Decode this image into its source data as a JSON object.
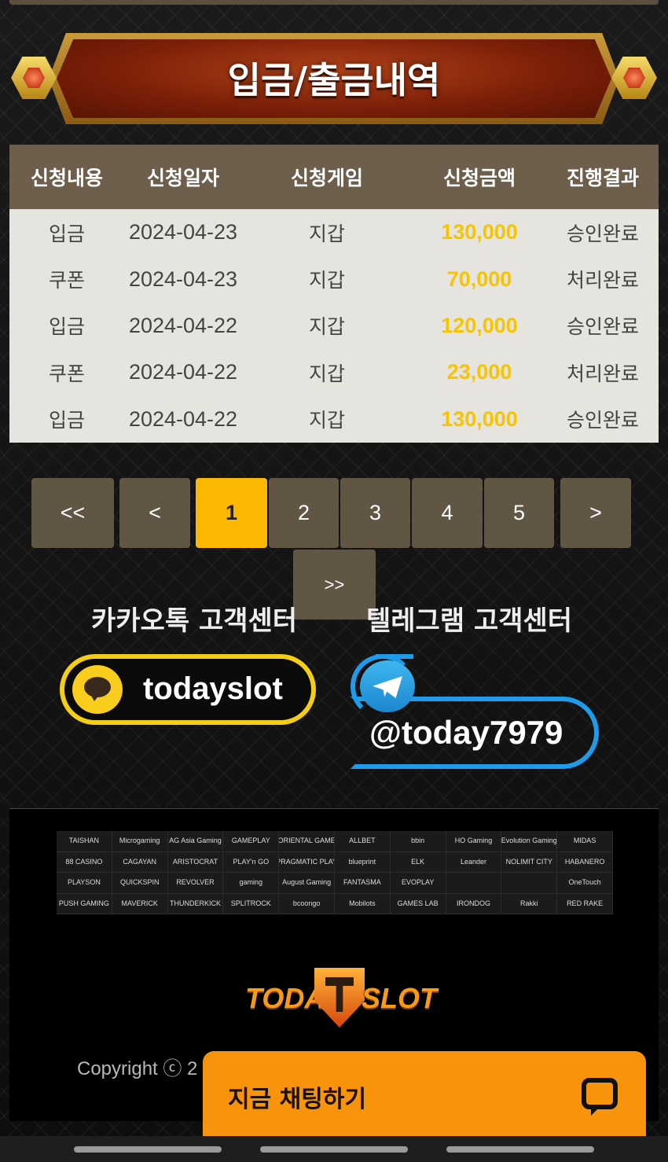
{
  "banner": {
    "title": "입금/출금내역"
  },
  "table": {
    "headers": [
      "신청내용",
      "신청일자",
      "신청게임",
      "신청금액",
      "진행결과"
    ],
    "rows": [
      [
        "입금",
        "2024-04-23",
        "지갑",
        "130,000",
        "승인완료"
      ],
      [
        "쿠폰",
        "2024-04-23",
        "지갑",
        "70,000",
        "처리완료"
      ],
      [
        "입금",
        "2024-04-22",
        "지갑",
        "120,000",
        "승인완료"
      ],
      [
        "쿠폰",
        "2024-04-22",
        "지갑",
        "23,000",
        "처리완료"
      ],
      [
        "입금",
        "2024-04-22",
        "지갑",
        "130,000",
        "승인완료"
      ]
    ]
  },
  "pagination": {
    "first": "<<",
    "prev": "<",
    "pages": [
      "1",
      "2",
      "3",
      "4",
      "5"
    ],
    "current": "1",
    "next": ">",
    "last": ">>"
  },
  "support": {
    "kakao_title": "카카오톡 고객센터",
    "kakao_id": "todayslot",
    "telegram_title": "텔레그램 고객센터",
    "telegram_id": "@today7979"
  },
  "providers": [
    "TAISHAN",
    "Microgaming",
    "AG Asia Gaming",
    "GAMEPLAY",
    "ORIENTAL GAME",
    "ALLBET",
    "bbin",
    "HO Gaming",
    "Evolution Gaming",
    "MIDAS",
    "88 CASINO",
    "CAGAYAN",
    "ARISTOCRAT",
    "PLAY'n GO",
    "PRAGMATIC PLAY",
    "blueprint",
    "ELK",
    "Leander",
    "NOLIMIT CITY",
    "HABANERO",
    "PLAYSON",
    "QUICKSPIN",
    "REVOLVER",
    "gaming",
    "August Gaming",
    "FANTASMA",
    "EVOPLAY",
    "",
    "",
    "OneTouch",
    "PUSH GAMING",
    "MAVERICK",
    "THUNDERKICK",
    "SPLITROCK",
    "bcoongo",
    "Mobilots",
    "GAMES LAB",
    "IRONDOG",
    "Rakki",
    "RED RAKE"
  ],
  "footer": {
    "logo_left": "TODAY",
    "logo_right": "SLOT",
    "copyright": "Copyright ⓒ 2"
  },
  "chat": {
    "label": "지금 채팅하기",
    "icon": "chat-bubble-icon"
  },
  "colors": {
    "accent": "#fcb800",
    "amount": "#f7c400",
    "chat": "#f7940c",
    "kakao": "#f4cd16",
    "telegram": "#1e9bea"
  }
}
